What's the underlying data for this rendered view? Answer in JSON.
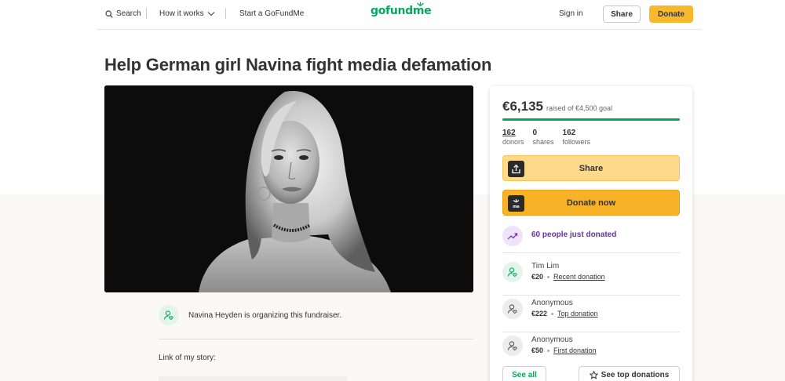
{
  "header": {
    "search_label": "Search",
    "how_it_works_label": "How it works",
    "start_label": "Start a GoFundMe",
    "logo_text": "gofundme",
    "sign_in_label": "Sign in",
    "share_label": "Share",
    "donate_label": "Donate"
  },
  "campaign": {
    "title": "Help German girl Navina fight media defamation",
    "organizer_text": "Navina Heyden is organizing this fundraiser.",
    "story_start": "Link of my story:"
  },
  "card": {
    "raised_amount": "€6,135",
    "goal_text": "raised of €4,500 goal",
    "progress_fraction": 1.0,
    "stats": [
      {
        "number": "162",
        "label": "donors"
      },
      {
        "number": "0",
        "label": "shares"
      },
      {
        "number": "162",
        "label": "followers"
      }
    ],
    "share_label": "Share",
    "donate_label": "Donate now",
    "just_donated": "60 people just donated",
    "donations": [
      {
        "name": "Tim Lim",
        "amount": "€20",
        "kind": "Recent donation"
      },
      {
        "name": "Anonymous",
        "amount": "€222",
        "kind": "Top donation"
      },
      {
        "name": "Anonymous",
        "amount": "€50",
        "kind": "First donation"
      }
    ],
    "see_all_label": "See all",
    "see_top_label": "See top donations"
  },
  "colors": {
    "brand_green": "#02a95c",
    "donate_yellow": "#f8b82c",
    "purple": "#6f2da8"
  },
  "icons": {
    "search": "search-icon",
    "chevron": "chevron-down-icon",
    "share": "share-upload-icon",
    "gofundme_badge": "gofundme-badge-icon",
    "trend": "trending-up-icon",
    "user": "user-heart-icon",
    "star": "star-icon"
  }
}
